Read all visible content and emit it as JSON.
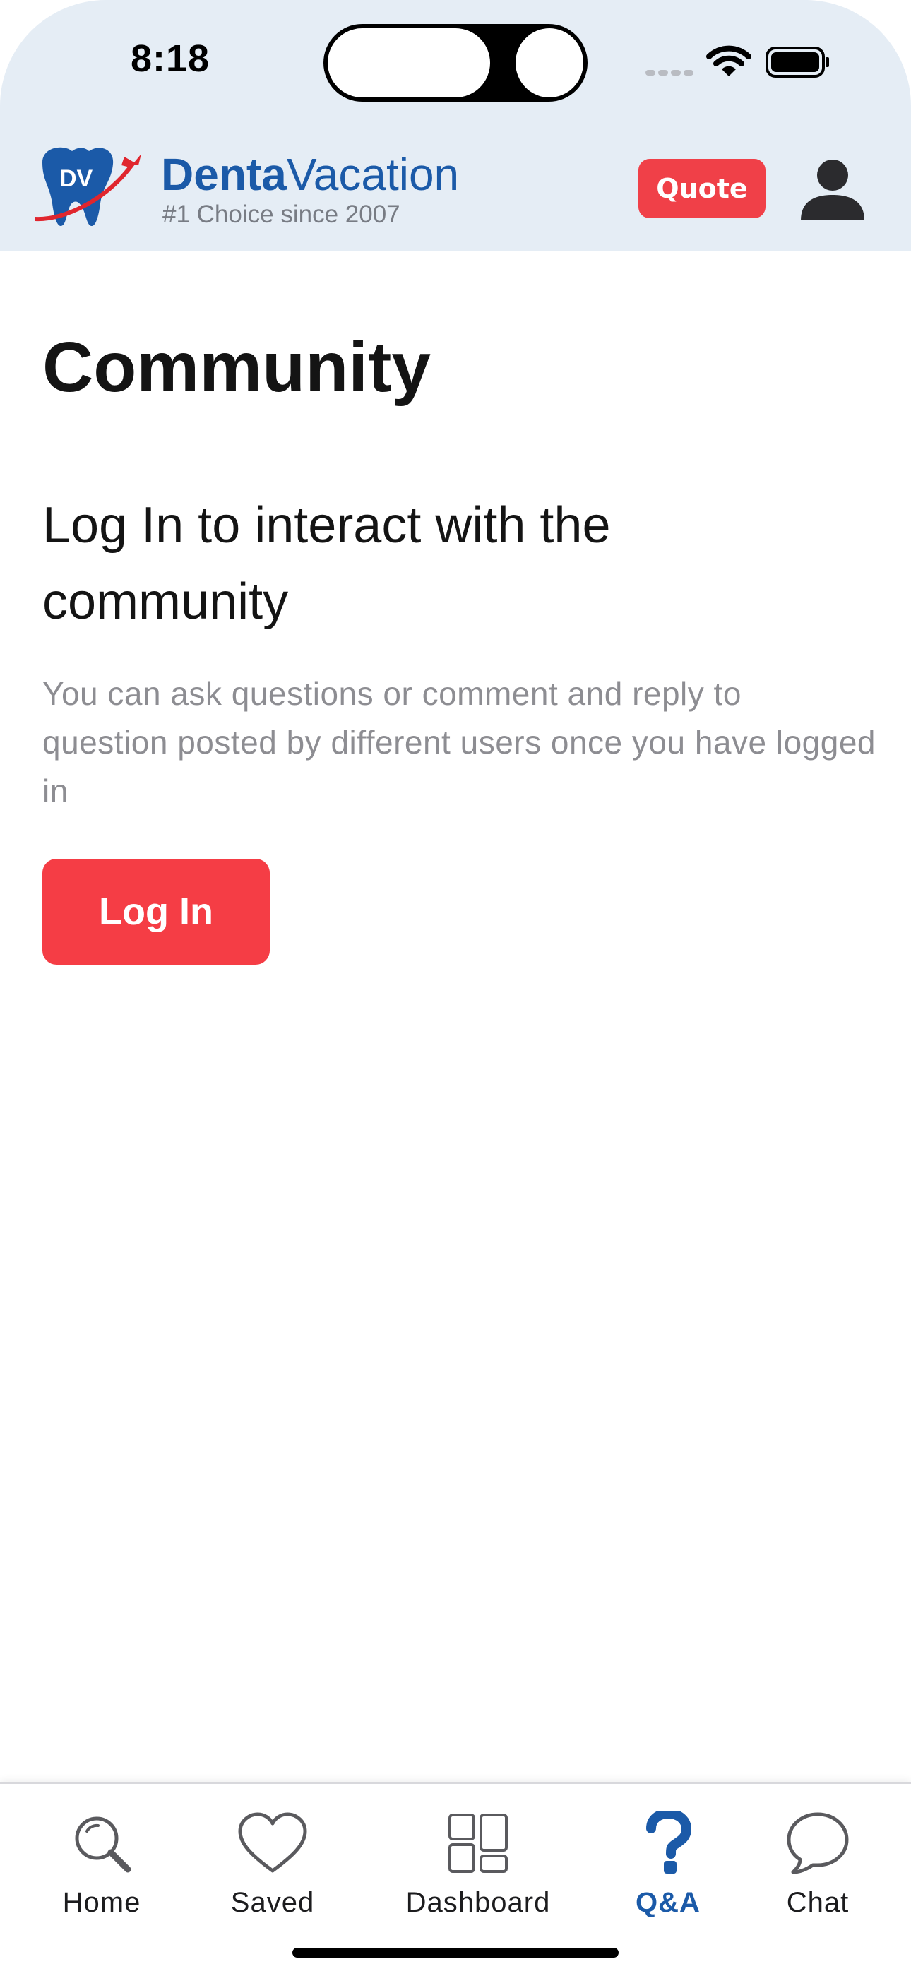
{
  "status_bar": {
    "time": "8:18"
  },
  "header": {
    "logo_initials": "DV",
    "brand_bold": "Denta",
    "brand_light": "Vacation",
    "tagline": "#1 Choice since 2007",
    "quote_label": "Quote"
  },
  "main": {
    "title": "Community",
    "login_heading": "Log In to interact with the community",
    "login_description": "You can ask questions or comment and reply to question posted by different users once you have logged in",
    "login_button": "Log In"
  },
  "tab_bar": {
    "tabs": [
      {
        "label": "Home",
        "icon": "search-icon",
        "active": false
      },
      {
        "label": "Saved",
        "icon": "heart-icon",
        "active": false
      },
      {
        "label": "Dashboard",
        "icon": "dashboard-icon",
        "active": false
      },
      {
        "label": "Q&A",
        "icon": "question-icon",
        "active": true
      },
      {
        "label": "Chat",
        "icon": "chat-bubble-icon",
        "active": false
      }
    ]
  },
  "colors": {
    "brand_blue": "#1b5aa8",
    "accent_red": "#f04048",
    "header_bg": "#e5edf5",
    "muted_text": "#8d8d92"
  }
}
